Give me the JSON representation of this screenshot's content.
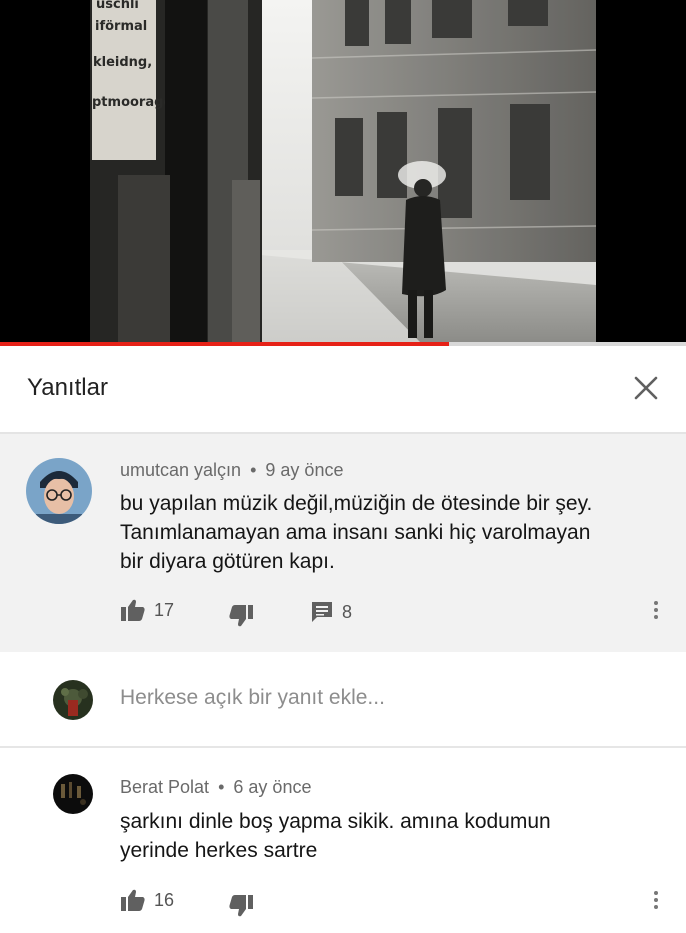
{
  "video": {
    "poster_text": [
      "uschli",
      "iförmal",
      "kleidng,",
      "ptmoorage"
    ],
    "progress_fraction": 0.655
  },
  "panel": {
    "title": "Yanıtlar",
    "close_icon": "close-icon"
  },
  "main_comment": {
    "author": "umutcan yalçın",
    "separator": "•",
    "time": "9 ay önce",
    "text_lines": [
      "bu yapılan müzik değil,müziğin de ötesinde bir şey.",
      "Tanımlanamayan ama insanı sanki hiç varolmayan",
      "bir diyara götüren kapı."
    ],
    "likes": "17",
    "replies": "8",
    "icons": {
      "like": "thumbs-up-icon",
      "dislike": "thumbs-down-icon",
      "reply": "reply-icon",
      "more": "more-vertical-icon"
    }
  },
  "reply_box": {
    "placeholder": "Herkese açık bir yanıt ekle..."
  },
  "reply_comment": {
    "author": "Berat Polat",
    "separator": "•",
    "time": "6 ay önce",
    "text_lines": [
      "şarkını dinle boş yapma sikik. amına kodumun",
      "yerinde herkes sartre"
    ],
    "likes": "16"
  },
  "colors": {
    "progress": "#e62117",
    "comment_bg": "#f2f2f2",
    "meta_text": "#6a6a6a",
    "icon": "#606060"
  }
}
